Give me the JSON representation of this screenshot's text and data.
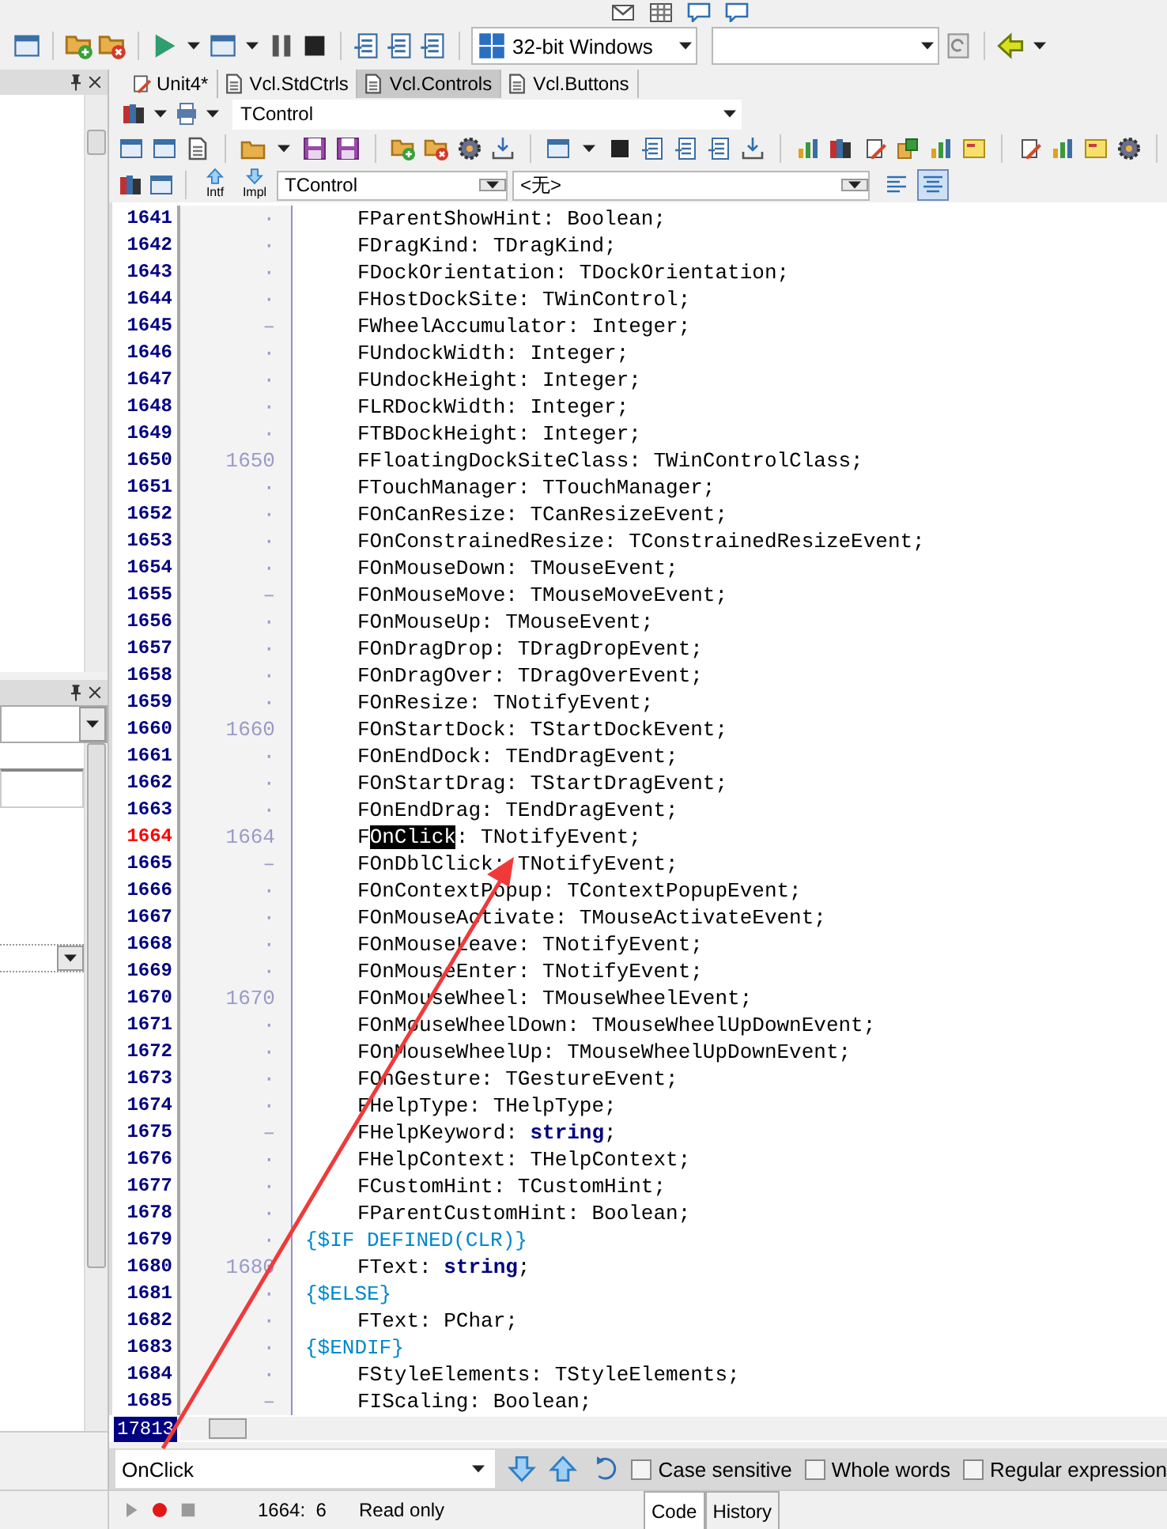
{
  "toolbar": {
    "platform": "32-bit Windows"
  },
  "editor_tabs": [
    {
      "label": "Unit4*",
      "selected": false,
      "modified": true
    },
    {
      "label": "Vcl.StdCtrls",
      "selected": false,
      "modified": false
    },
    {
      "label": "Vcl.Controls",
      "selected": true,
      "modified": false
    },
    {
      "label": "Vcl.Buttons",
      "selected": false,
      "modified": false
    }
  ],
  "type_combo": "TControl",
  "nav_labels": [
    "Intf",
    "Impl"
  ],
  "class_combo": "TControl",
  "member_combo": "<无>",
  "view_toggles": [
    {
      "selected": false
    },
    {
      "selected": true
    }
  ],
  "lines": [
    {
      "no": "1641",
      "mark": "·",
      "kind": "code",
      "text": "FParentShowHint: Boolean;",
      "current": false
    },
    {
      "no": "1642",
      "mark": "·",
      "kind": "code",
      "text": "FDragKind: TDragKind;",
      "current": false
    },
    {
      "no": "1643",
      "mark": "·",
      "kind": "code",
      "text": "FDockOrientation: TDockOrientation;",
      "current": false
    },
    {
      "no": "1644",
      "mark": "·",
      "kind": "code",
      "text": "FHostDockSite: TWinControl;",
      "current": false
    },
    {
      "no": "1645",
      "mark": "–",
      "kind": "code",
      "text": "FWheelAccumulator: Integer;",
      "current": false
    },
    {
      "no": "1646",
      "mark": "·",
      "kind": "code",
      "text": "FUndockWidth: Integer;",
      "current": false
    },
    {
      "no": "1647",
      "mark": "·",
      "kind": "code",
      "text": "FUndockHeight: Integer;",
      "current": false
    },
    {
      "no": "1648",
      "mark": "·",
      "kind": "code",
      "text": "FLRDockWidth: Integer;",
      "current": false
    },
    {
      "no": "1649",
      "mark": "·",
      "kind": "code",
      "text": "FTBDockHeight: Integer;",
      "current": false
    },
    {
      "no": "1650",
      "mark": "1650",
      "kind": "code",
      "text": "FFloatingDockSiteClass: TWinControlClass;",
      "current": false
    },
    {
      "no": "1651",
      "mark": "·",
      "kind": "code",
      "text": "FTouchManager: TTouchManager;",
      "current": false
    },
    {
      "no": "1652",
      "mark": "·",
      "kind": "code",
      "text": "FOnCanResize: TCanResizeEvent;",
      "current": false
    },
    {
      "no": "1653",
      "mark": "·",
      "kind": "code",
      "text": "FOnConstrainedResize: TConstrainedResizeEvent;",
      "current": false
    },
    {
      "no": "1654",
      "mark": "·",
      "kind": "code",
      "text": "FOnMouseDown: TMouseEvent;",
      "current": false
    },
    {
      "no": "1655",
      "mark": "–",
      "kind": "code",
      "text": "FOnMouseMove: TMouseMoveEvent;",
      "current": false
    },
    {
      "no": "1656",
      "mark": "·",
      "kind": "code",
      "text": "FOnMouseUp: TMouseEvent;",
      "current": false
    },
    {
      "no": "1657",
      "mark": "·",
      "kind": "code",
      "text": "FOnDragDrop: TDragDropEvent;",
      "current": false
    },
    {
      "no": "1658",
      "mark": "·",
      "kind": "code",
      "text": "FOnDragOver: TDragOverEvent;",
      "current": false
    },
    {
      "no": "1659",
      "mark": "·",
      "kind": "code",
      "text": "FOnResize: TNotifyEvent;",
      "current": false
    },
    {
      "no": "1660",
      "mark": "1660",
      "kind": "code",
      "text": "FOnStartDock: TStartDockEvent;",
      "current": false
    },
    {
      "no": "1661",
      "mark": "·",
      "kind": "code",
      "text": "FOnEndDock: TEndDragEvent;",
      "current": false
    },
    {
      "no": "1662",
      "mark": "·",
      "kind": "code",
      "text": "FOnStartDrag: TStartDragEvent;",
      "current": false
    },
    {
      "no": "1663",
      "mark": "·",
      "kind": "code",
      "text": "FOnEndDrag: TEndDragEvent;",
      "current": false
    },
    {
      "no": "1664",
      "mark": "1664",
      "kind": "match",
      "parts": [
        {
          "text": "F",
          "found": false
        },
        {
          "text": "OnClick",
          "found": true
        },
        {
          "text": ": TNotifyEvent;",
          "found": false
        }
      ],
      "current": true
    },
    {
      "no": "1665",
      "mark": "–",
      "kind": "code",
      "text": "FOnDblClick: TNotifyEvent;",
      "current": false
    },
    {
      "no": "1666",
      "mark": "·",
      "kind": "code",
      "text": "FOnContextPopup: TContextPopupEvent;",
      "current": false
    },
    {
      "no": "1667",
      "mark": "·",
      "kind": "code",
      "text": "FOnMouseActivate: TMouseActivateEvent;",
      "current": false
    },
    {
      "no": "1668",
      "mark": "·",
      "kind": "code",
      "text": "FOnMouseLeave: TNotifyEvent;",
      "current": false
    },
    {
      "no": "1669",
      "mark": "·",
      "kind": "code",
      "text": "FOnMouseEnter: TNotifyEvent;",
      "current": false
    },
    {
      "no": "1670",
      "mark": "1670",
      "kind": "code",
      "text": "FOnMouseWheel: TMouseWheelEvent;",
      "current": false
    },
    {
      "no": "1671",
      "mark": "·",
      "kind": "code",
      "text": "FOnMouseWheelDown: TMouseWheelUpDownEvent;",
      "current": false
    },
    {
      "no": "1672",
      "mark": "·",
      "kind": "code",
      "text": "FOnMouseWheelUp: TMouseWheelUpDownEvent;",
      "current": false
    },
    {
      "no": "1673",
      "mark": "·",
      "kind": "code",
      "text": "FOnGesture: TGestureEvent;",
      "current": false
    },
    {
      "no": "1674",
      "mark": "·",
      "kind": "code",
      "text": "FHelpType: THelpType;",
      "current": false
    },
    {
      "no": "1675",
      "mark": "–",
      "kind": "code",
      "text": "FHelpKeyword: **string**;",
      "current": false
    },
    {
      "no": "1676",
      "mark": "·",
      "kind": "code",
      "text": "FHelpContext: THelpContext;",
      "current": false
    },
    {
      "no": "1677",
      "mark": "·",
      "kind": "code",
      "text": "FCustomHint: TCustomHint;",
      "current": false
    },
    {
      "no": "1678",
      "mark": "·",
      "kind": "code",
      "text": "FParentCustomHint: Boolean;",
      "current": false
    },
    {
      "no": "1679",
      "mark": "·",
      "kind": "directive",
      "text": "{$IF DEFINED(CLR)}",
      "current": false
    },
    {
      "no": "1680",
      "mark": "1680",
      "kind": "code",
      "text": "FText: **string**;",
      "current": false
    },
    {
      "no": "1681",
      "mark": "·",
      "kind": "directive",
      "text": "{$ELSE}",
      "current": false
    },
    {
      "no": "1682",
      "mark": "·",
      "kind": "code",
      "text": "FText: PChar;",
      "current": false
    },
    {
      "no": "1683",
      "mark": "·",
      "kind": "directive",
      "text": "{$ENDIF}",
      "current": false
    },
    {
      "no": "1684",
      "mark": "·",
      "kind": "code",
      "text": "FStyleElements: TStyleElements;",
      "current": false
    },
    {
      "no": "1685",
      "mark": "–",
      "kind": "code",
      "text": "FIScaling: Boolean;",
      "current": false
    }
  ],
  "line_total": "17813",
  "find": {
    "value": "OnClick",
    "options": [
      {
        "label": "Case sensitive",
        "checked": false
      },
      {
        "label": "Whole words",
        "checked": false
      },
      {
        "label": "Regular expression",
        "checked": false
      }
    ]
  },
  "status": {
    "position": "1664:  6",
    "mode": "Read only"
  },
  "bottom_tabs": [
    {
      "label": "Code",
      "selected": true
    },
    {
      "label": "History",
      "selected": false
    }
  ]
}
